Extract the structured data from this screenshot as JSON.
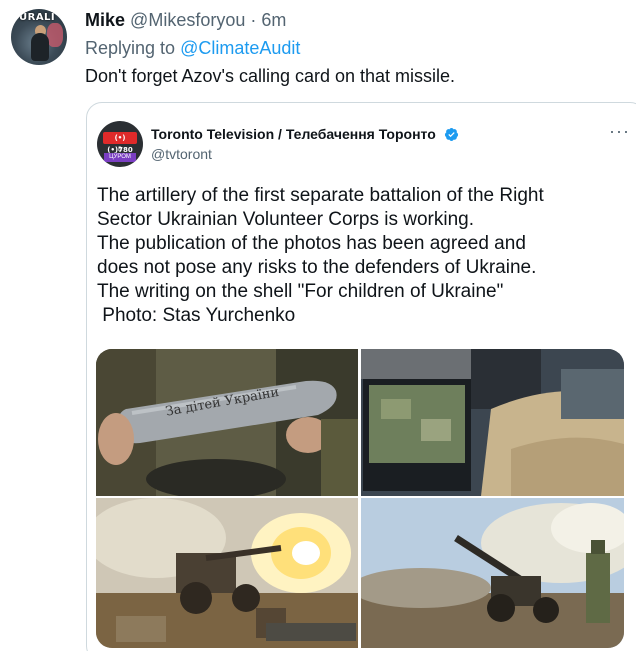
{
  "tweet": {
    "author_name": "Mike",
    "author_handle": "@Mikesforyou",
    "separator": "·",
    "time": "6m",
    "replying_label": "Replying to",
    "replying_to": "@ClimateAudit",
    "text": "Don't forget Azov's calling card on that missile.",
    "avatar_caption": "URALI"
  },
  "quote": {
    "author_name": "Toronto Television / Телебачення Торонто",
    "author_handle": "@tvtoront",
    "more_icon": "more-horizontal-icon",
    "verified_icon": "verified-badge-icon",
    "accent_color": "#1d9bf0",
    "avatar_top": "(•)(•)780",
    "avatar_mid": "В НАЙКЛОН",
    "avatar_bot": "ЦУРОМ",
    "text_lines": [
      "The artillery of the first separate battalion of the Right",
      "Sector Ukrainian Volunteer Corps is working.",
      "The publication of the photos has been agreed and",
      "does not pose any risks to the defenders of Ukraine.",
      "The writing on the shell \"For children of Ukraine\"",
      " Photo: Stas Yurchenko"
    ],
    "shell_writing": "За дітей України"
  }
}
